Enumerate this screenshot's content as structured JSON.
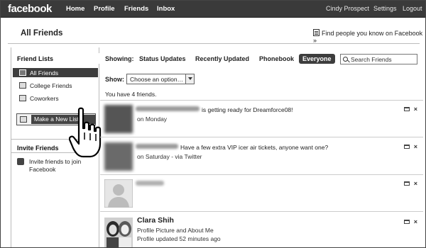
{
  "topnav": {
    "logo": "facebook",
    "links": [
      "Home",
      "Profile",
      "Friends",
      "Inbox"
    ],
    "user_name": "Cindy Prospect",
    "settings": "Settings",
    "logout": "Logout"
  },
  "header": {
    "title": "All Friends",
    "find_people": "Find people you know on Facebook »"
  },
  "sidebar": {
    "lists_heading": "Friend Lists",
    "items": [
      {
        "label": "All Friends",
        "icon": "people-icon",
        "selected": true
      },
      {
        "label": "College Friends",
        "icon": "list-icon",
        "selected": false
      },
      {
        "label": "Coworkers",
        "icon": "list-icon",
        "selected": false
      }
    ],
    "make_list": "Make a New List",
    "invite_heading": "Invite Friends",
    "invite_text": "Invite friends to join Facebook"
  },
  "filters": {
    "showing_label": "Showing:",
    "options": [
      "Status Updates",
      "Recently Updated",
      "Phonebook",
      "Everyone"
    ],
    "active": "Everyone",
    "search_placeholder": "Search Friends",
    "show_label": "Show:",
    "show_select_value": "Choose an option…"
  },
  "friend_count_text": "You have 4 friends.",
  "friends": [
    {
      "status": "is getting ready for Dreamforce08!",
      "sub": "on Monday"
    },
    {
      "status": "Have a few extra VIP icer air tickets, anyone want one?",
      "sub": "on Saturday - via Twitter"
    },
    {
      "status": "",
      "sub": ""
    },
    {
      "name": "Clara Shih",
      "line1": "Profile Picture and About Me",
      "line2": "Profile updated 52 minutes ago"
    }
  ],
  "colors": {
    "topbar": "#3a3a3a",
    "selected_bg": "#3d3d3d",
    "divider": "#cccccc"
  }
}
